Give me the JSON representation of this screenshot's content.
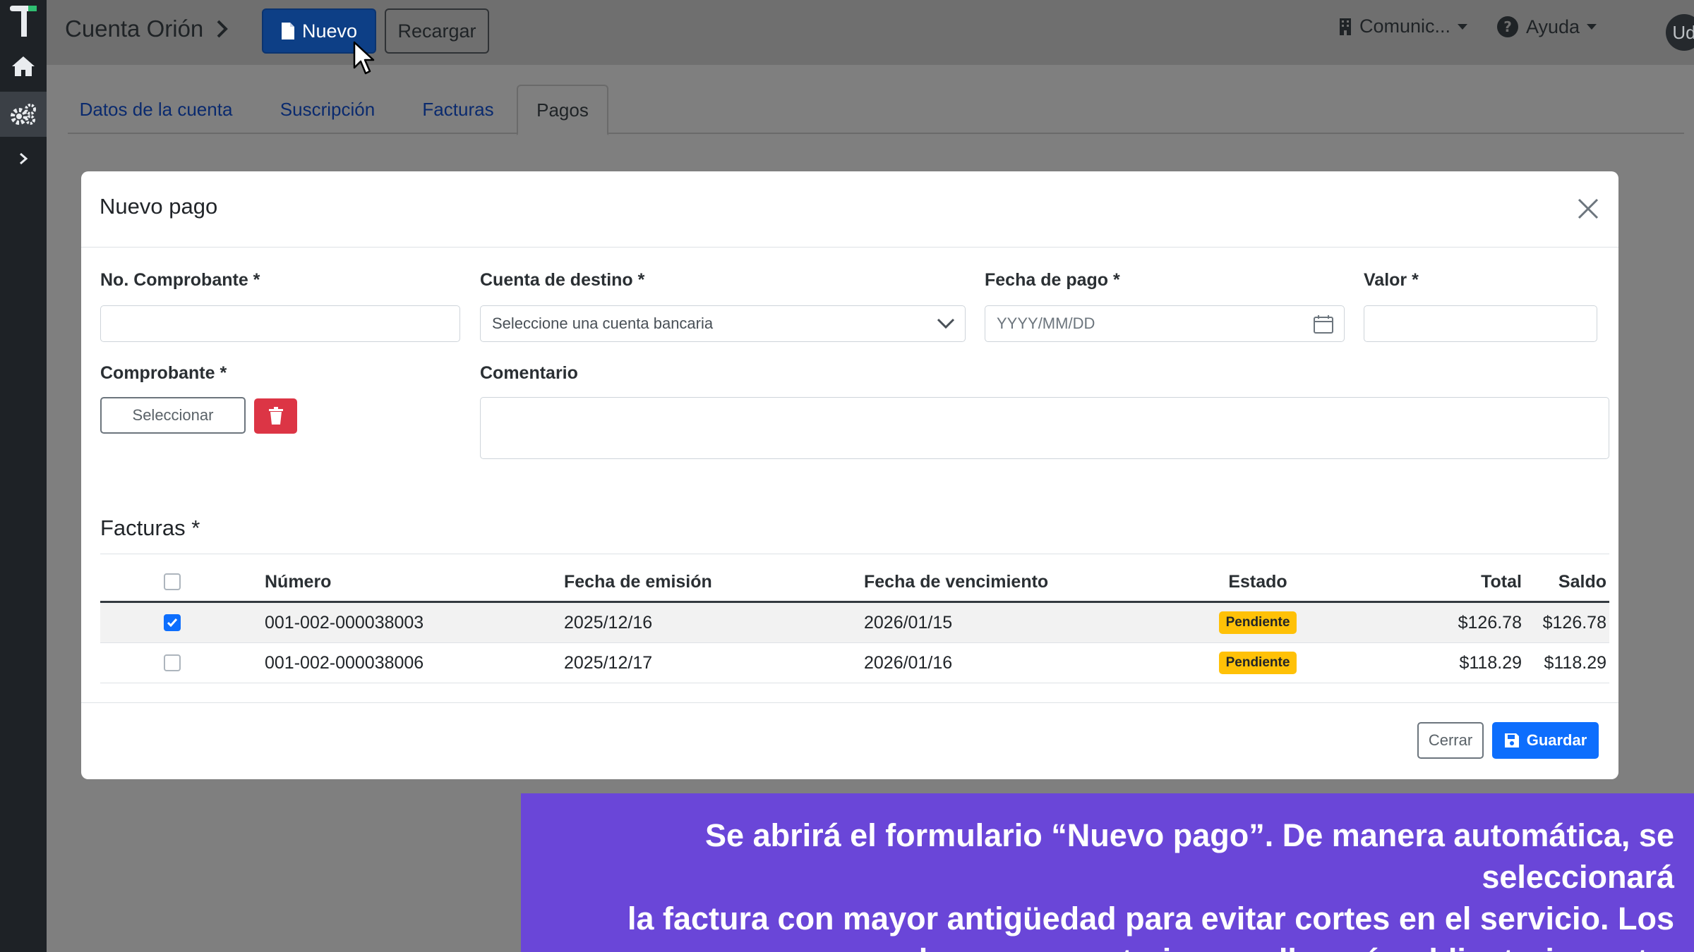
{
  "header": {
    "breadcrumb": "Cuenta Orión",
    "new_button": "Nuevo",
    "reload_button": "Recargar",
    "org_menu": "Comunic...",
    "help_menu": "Ayuda",
    "user_initials": "Ud"
  },
  "tabs": [
    {
      "label": "Datos de la cuenta",
      "active": false
    },
    {
      "label": "Suscripción",
      "active": false
    },
    {
      "label": "Facturas",
      "active": false
    },
    {
      "label": "Pagos",
      "active": true
    }
  ],
  "modal": {
    "title": "Nuevo pago",
    "fields": {
      "comprobante_no_label": "No. Comprobante *",
      "comprobante_no_value": "",
      "cuenta_destino_label": "Cuenta de destino *",
      "cuenta_destino_placeholder": "Seleccione una cuenta bancaria",
      "fecha_pago_label": "Fecha de pago *",
      "fecha_pago_placeholder": "YYYY/MM/DD",
      "valor_label": "Valor *",
      "valor_value": "",
      "comprobante_label": "Comprobante *",
      "select_button": "Seleccionar",
      "comentario_label": "Comentario",
      "comentario_value": ""
    },
    "invoices": {
      "title": "Facturas *",
      "columns": [
        "Número",
        "Fecha de emisión",
        "Fecha de vencimiento",
        "Estado",
        "Total",
        "Saldo"
      ],
      "rows": [
        {
          "checked": true,
          "numero": "001-002-000038003",
          "emision": "2025/12/16",
          "vencimiento": "2026/01/15",
          "estado": "Pendiente",
          "total": "$126.78",
          "saldo": "$126.78"
        },
        {
          "checked": false,
          "numero": "001-002-000038006",
          "emision": "2025/12/17",
          "vencimiento": "2026/01/16",
          "estado": "Pendiente",
          "total": "$118.29",
          "saldo": "$118.29"
        }
      ]
    },
    "footer": {
      "close_button": "Cerrar",
      "save_button": "Guardar"
    }
  },
  "caption": {
    "line1": "Se abrirá el formulario “Nuevo pago”. De manera automática, se seleccionará",
    "line2": "la factura con mayor antigüedad para evitar cortes en el servicio. Los",
    "line3": "campos marcados con un asterisco se llenarán obligatoriamente."
  },
  "colors": {
    "primary": "#0d6efd",
    "danger": "#dc3545",
    "warning": "#ffc107",
    "caption_bg": "#6a46d8",
    "sidebar_bg": "#1e2226"
  }
}
